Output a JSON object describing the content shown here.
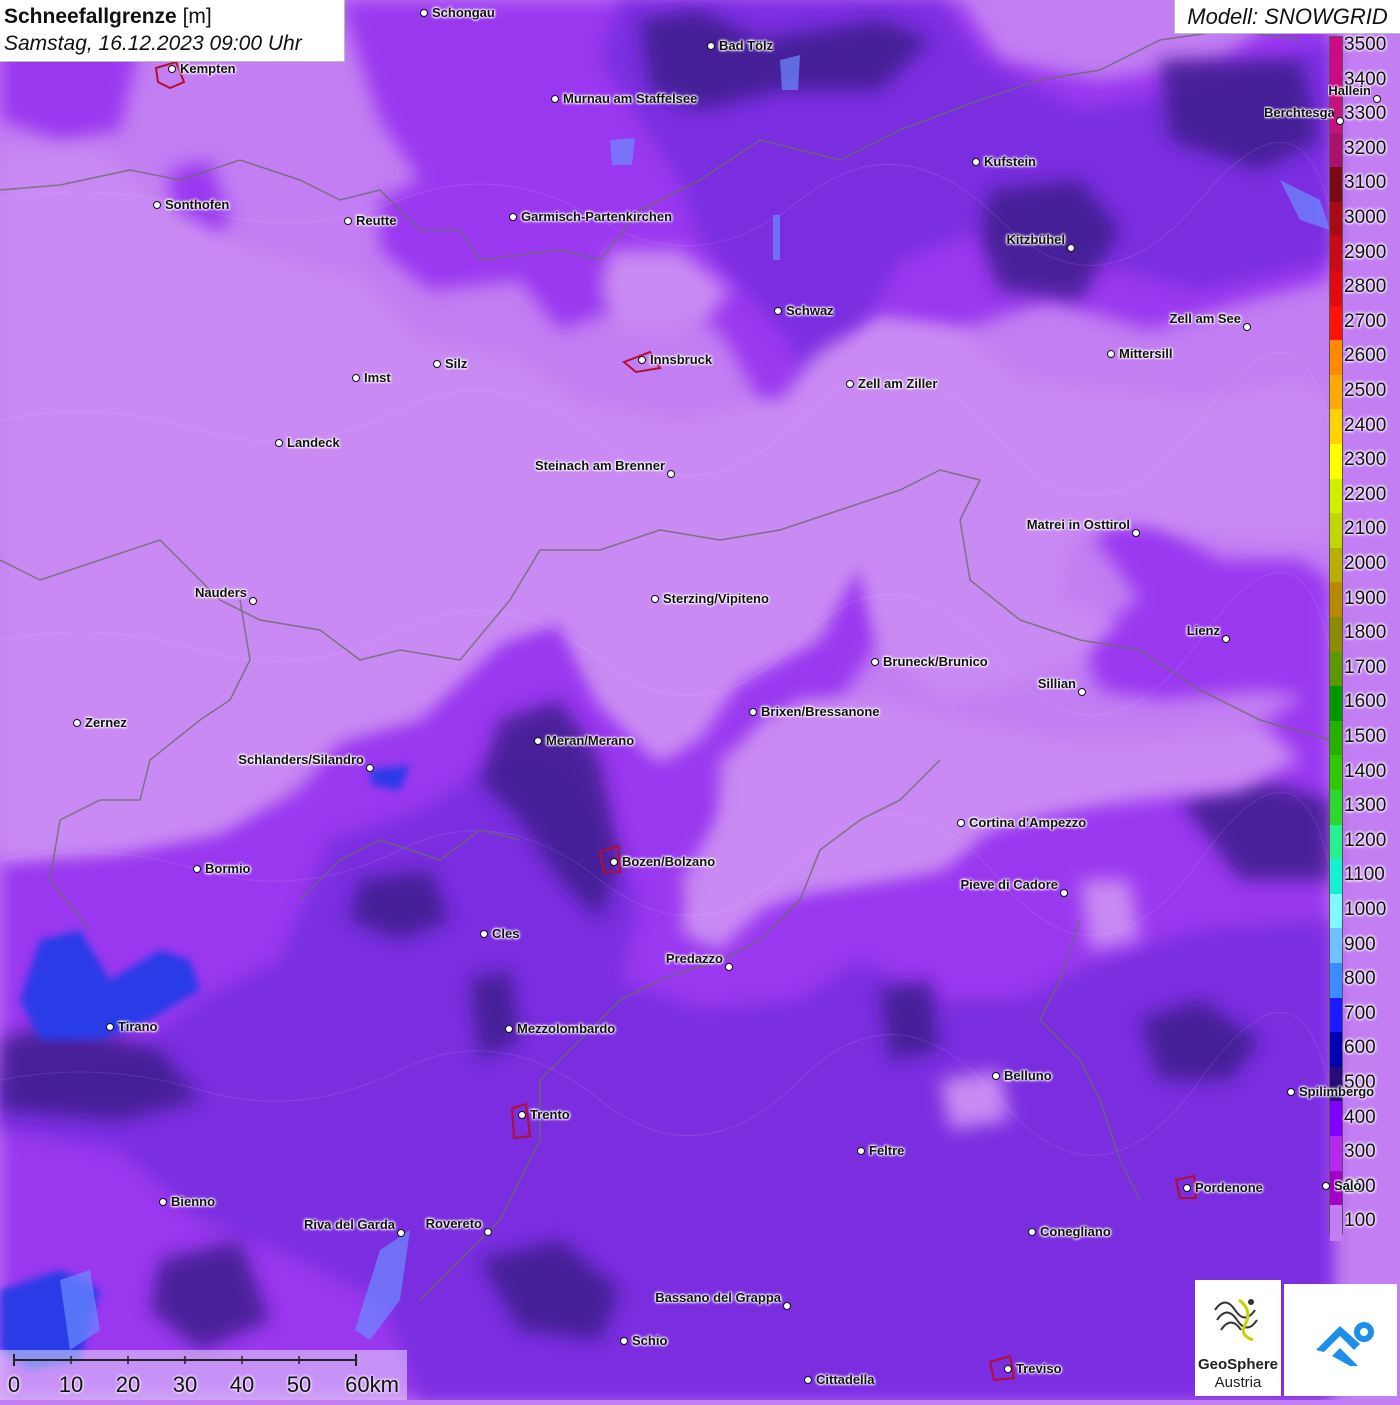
{
  "title": {
    "main": "Schneefallgrenze",
    "unit": "[m]",
    "date": "Samstag, 16.12.2023 09:00 Uhr"
  },
  "model": "Modell: SNOWGRID",
  "legend": {
    "labels": [
      "3500",
      "3400",
      "3300",
      "3200",
      "3100",
      "3000",
      "2900",
      "2800",
      "2700",
      "2600",
      "2500",
      "2400",
      "2300",
      "2200",
      "2100",
      "2000",
      "1900",
      "1800",
      "1700",
      "1600",
      "1500",
      "1400",
      "1300",
      "1200",
      "1100",
      "1000",
      "900",
      "800",
      "700",
      "600",
      "500",
      "400",
      "300",
      "200",
      "100"
    ],
    "colors": [
      "#cc0a82",
      "#cc0a82",
      "#c4127f",
      "#a8126d",
      "#7a0a16",
      "#aa0a16",
      "#c80a16",
      "#e00a10",
      "#ff1208",
      "#ff8a00",
      "#ffaa00",
      "#ffd200",
      "#ffff00",
      "#d0f000",
      "#c0d800",
      "#b8b000",
      "#b88a00",
      "#8c8c00",
      "#5a9a00",
      "#009600",
      "#28b000",
      "#30c800",
      "#2cd830",
      "#28f08c",
      "#18f0d2",
      "#80f8ff",
      "#70c0ff",
      "#3a8cff",
      "#1a1aff",
      "#0000b0",
      "#2a0a7a",
      "#8000ff",
      "#b428f0",
      "#a000c8",
      "#c27ef2"
    ]
  },
  "cities": [
    {
      "name": "Schongau"
    },
    {
      "name": "Bad Tölz"
    },
    {
      "name": "Kempten"
    },
    {
      "name": "Murnau am Staffelsee"
    },
    {
      "name": "Berchtesgaden"
    },
    {
      "name": "Kufstein"
    },
    {
      "name": "Sonthofen"
    },
    {
      "name": "Reutte"
    },
    {
      "name": "Garmisch-Partenkirchen"
    },
    {
      "name": "Kitzbühel"
    },
    {
      "name": "Schwaz"
    },
    {
      "name": "Zell am See"
    },
    {
      "name": "Innsbruck"
    },
    {
      "name": "Mittersill"
    },
    {
      "name": "Imst"
    },
    {
      "name": "Silz"
    },
    {
      "name": "Zell am Ziller"
    },
    {
      "name": "Landeck"
    },
    {
      "name": "Steinach am Brenner"
    },
    {
      "name": "Matrei in Osttirol"
    },
    {
      "name": "Nauders"
    },
    {
      "name": "Sterzing/Vipiteno"
    },
    {
      "name": "Lienz"
    },
    {
      "name": "Bruneck/Brunico"
    },
    {
      "name": "Sillian"
    },
    {
      "name": "Zernez"
    },
    {
      "name": "Brixen/Bressanone"
    },
    {
      "name": "Meran/Merano"
    },
    {
      "name": "Schlanders/Silandro"
    },
    {
      "name": "Cortina d'Ampezzo"
    },
    {
      "name": "Bozen/Bolzano"
    },
    {
      "name": "Bormio"
    },
    {
      "name": "Pieve di Cadore"
    },
    {
      "name": "Cles"
    },
    {
      "name": "Predazzo"
    },
    {
      "name": "Tirano"
    },
    {
      "name": "Mezzolombardo"
    },
    {
      "name": "Belluno"
    },
    {
      "name": "Spilimbergo"
    },
    {
      "name": "Trento"
    },
    {
      "name": "Feltre"
    },
    {
      "name": "Pordenone"
    },
    {
      "name": "Bienno"
    },
    {
      "name": "Riva del Garda"
    },
    {
      "name": "Rovereto"
    },
    {
      "name": "Conegliano"
    },
    {
      "name": "Bassano del Grappa"
    },
    {
      "name": "Schio"
    },
    {
      "name": "Treviso"
    },
    {
      "name": "Cittadella"
    },
    {
      "name": "Hallein"
    },
    {
      "name": "Salò"
    }
  ],
  "scalebar": {
    "labels": [
      "0",
      "10",
      "20",
      "30",
      "40",
      "50",
      "60km"
    ]
  },
  "logos": {
    "geosphere": "GeoSphere",
    "austria": "Austria",
    "geosphere_icon": "geosphere-logo-icon",
    "app_icon": "app-logo-icon"
  }
}
